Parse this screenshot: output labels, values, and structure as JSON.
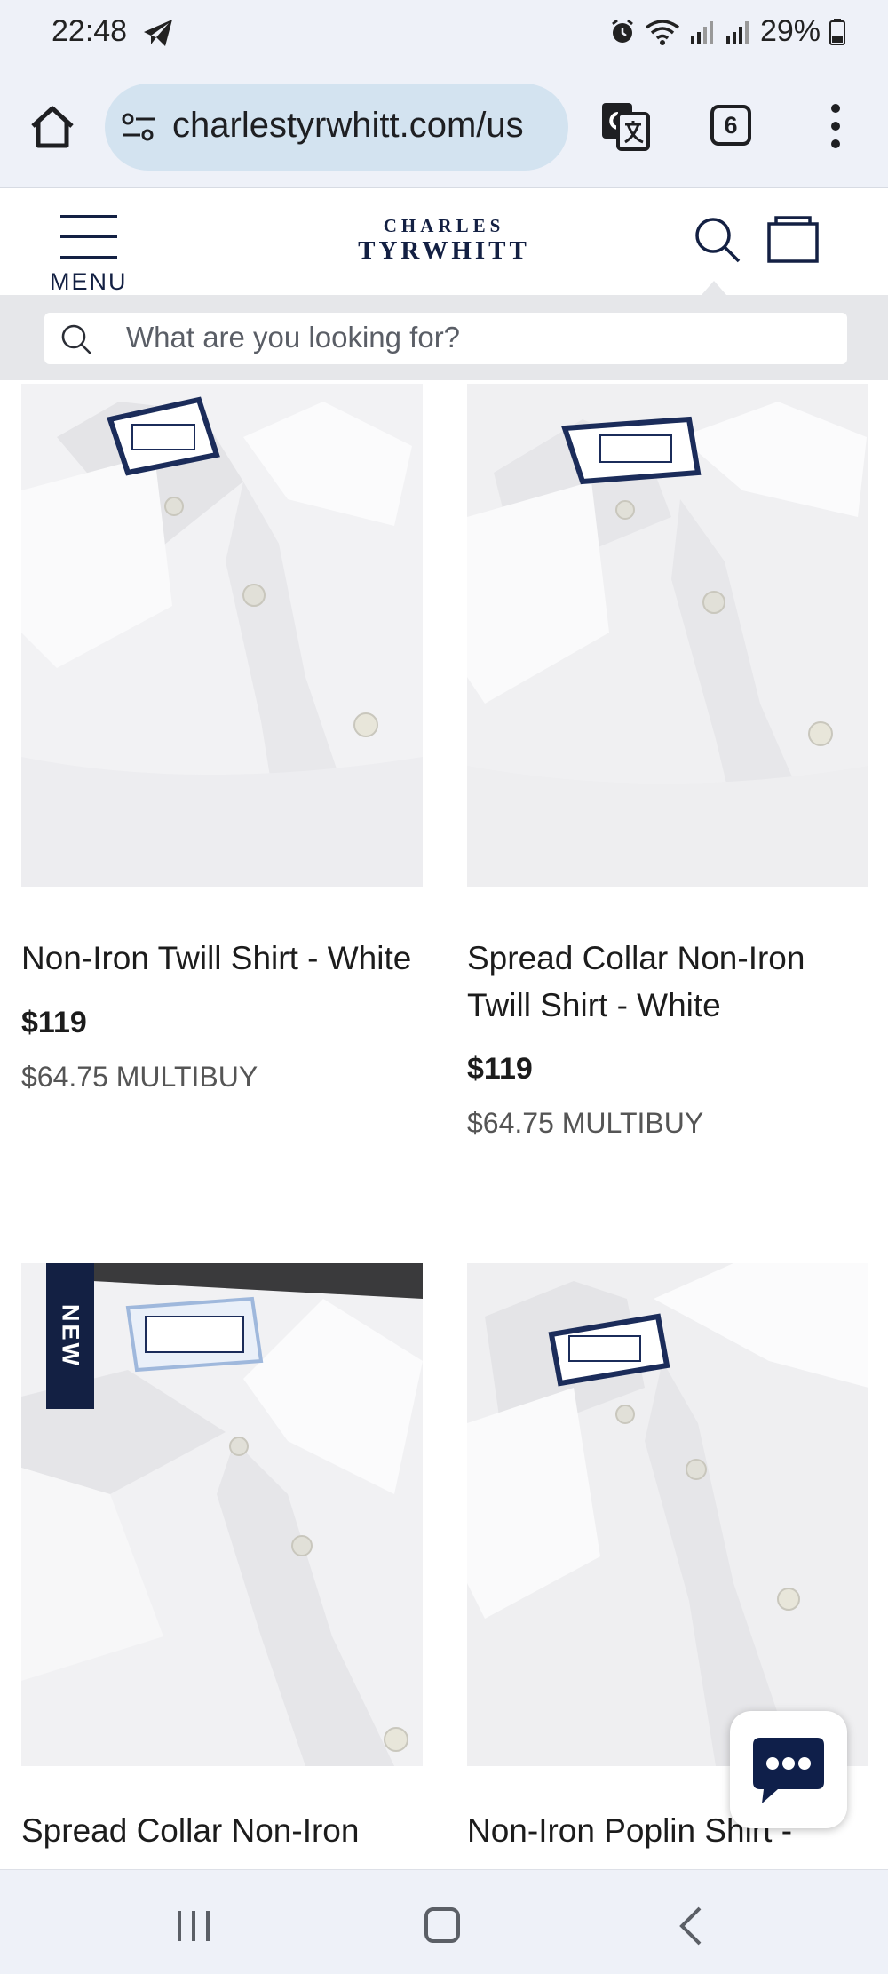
{
  "status_bar": {
    "time": "22:48",
    "battery": "29%",
    "icons": [
      "telegram-send-icon",
      "alarm-icon",
      "wifi-icon",
      "signal-icon",
      "signal-icon",
      "battery-icon"
    ]
  },
  "browser": {
    "url": "charlestyrwhitt.com/us",
    "tab_count": "6"
  },
  "site_header": {
    "menu_label": "MENU",
    "logo_top": "CHARLES",
    "logo_bottom": "TYRWHITT"
  },
  "search": {
    "placeholder": "What are you looking for?"
  },
  "products": [
    {
      "name": "Non-Iron Twill Shirt - White",
      "price": "$119",
      "multibuy": "$64.75 MULTIBUY"
    },
    {
      "name": "Spread Collar Non-Iron Twill Shirt - White",
      "price": "$119",
      "multibuy": "$64.75 MULTIBUY"
    },
    {
      "name": "Spread Collar Non-Iron",
      "badge": "NEW"
    },
    {
      "name": "Non-Iron Poplin Shirt -"
    }
  ],
  "colors": {
    "brand_navy": "#132043",
    "chat_navy": "#0f1f4a",
    "browser_bg": "#eef1f8",
    "url_pill": "#d3e3f0"
  }
}
